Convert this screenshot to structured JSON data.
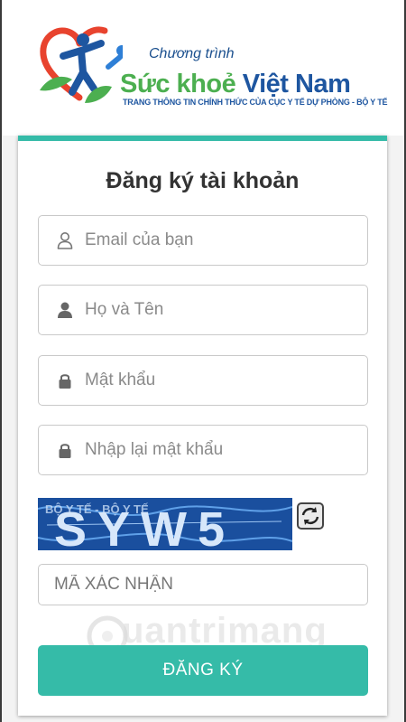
{
  "header": {
    "logo_small": "Chương trình",
    "logo_big_part1": "Sức khoẻ",
    "logo_big_part2": "Việt Nam",
    "logo_tagline": "TRANG THÔNG TIN CHÍNH THỨC CỦA CỤC Y TẾ DỰ PHÒNG - BỘ Y TẾ"
  },
  "form": {
    "title": "Đăng ký tài khoản",
    "email_placeholder": "Email của bạn",
    "name_placeholder": "Họ và Tên",
    "password_placeholder": "Mật khẩu",
    "confirm_password_placeholder": "Nhập lại mật khẩu",
    "captcha_text": "SYW5",
    "captcha_noise": "BỘ Y TẾ - BỘ Y TẾ",
    "captcha_code_placeholder": "MÃ XÁC NHẬN",
    "submit_label": "ĐĂNG KÝ"
  },
  "watermark": {
    "text": "uantrimang"
  },
  "colors": {
    "accent": "#35bba8",
    "brand_blue": "#1e56a0",
    "brand_green": "#4caf50",
    "logo_red": "#e8432e"
  },
  "icons": {
    "email": "person-outline-icon",
    "name": "person-icon",
    "password": "lock-icon",
    "confirm_password": "lock-icon",
    "refresh": "refresh-icon"
  }
}
